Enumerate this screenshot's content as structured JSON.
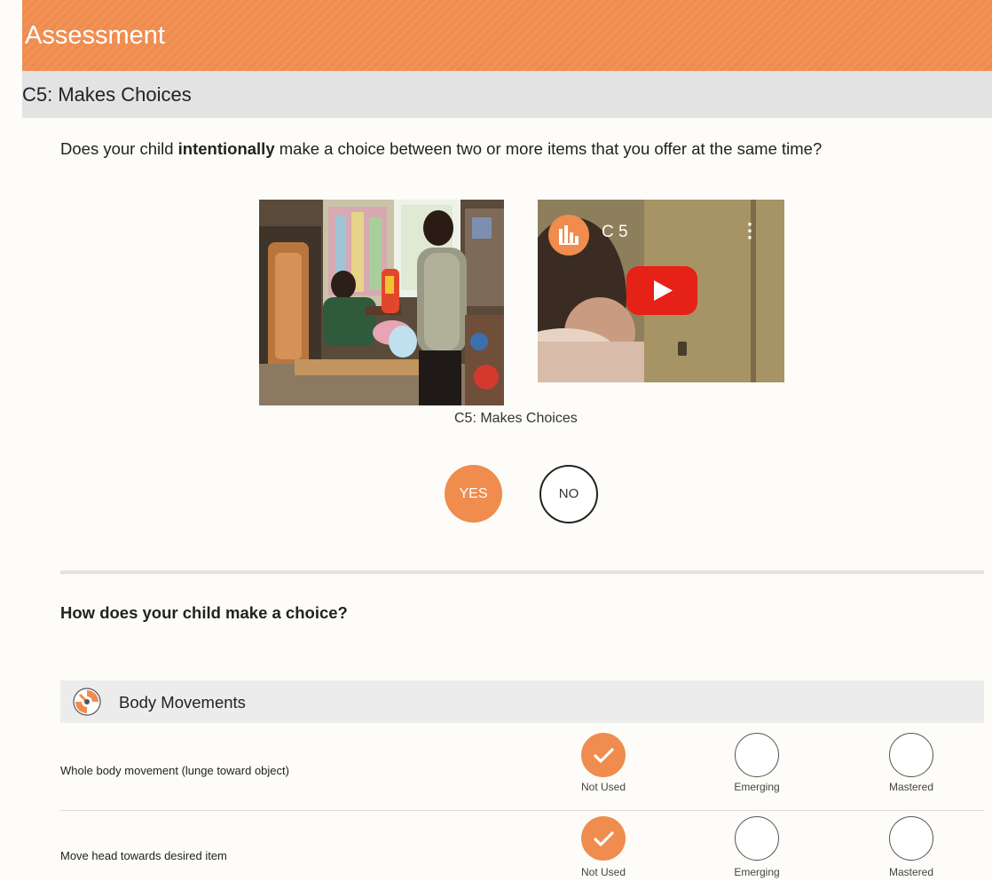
{
  "header": {
    "title": "Assessment"
  },
  "section": {
    "title": "C5: Makes Choices"
  },
  "question": {
    "before": "Does your child ",
    "bold": "intentionally",
    "after": " make a choice between two or more items that you offer at the same time?"
  },
  "video": {
    "title": "C 5",
    "caption": "C5: Makes Choices"
  },
  "answer": {
    "yes_label": "YES",
    "no_label": "NO",
    "selected": "YES"
  },
  "followup": {
    "question": "How does your child make a choice?"
  },
  "category": {
    "label": "Body Movements"
  },
  "options": [
    "Not Used",
    "Emerging",
    "Mastered"
  ],
  "rows": [
    {
      "label": "Whole body movement (lunge toward object)",
      "selected": "Not Used"
    },
    {
      "label": "Move head towards desired item",
      "selected": "Not Used"
    }
  ],
  "colors": {
    "accent": "#ef8c4e",
    "section_bg": "#e3e3e3",
    "youtube_red": "#e62117"
  }
}
